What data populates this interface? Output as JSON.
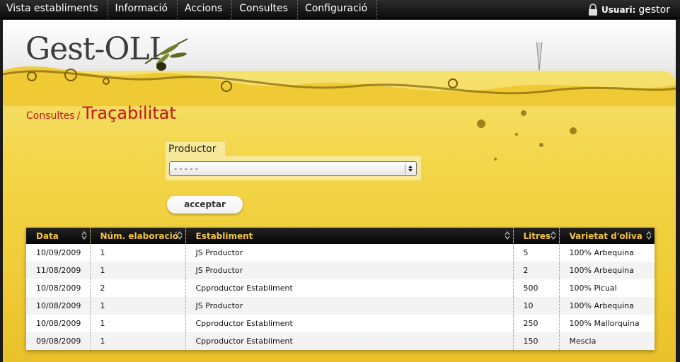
{
  "nav": {
    "items": [
      "Vista establiments",
      "Informació",
      "Accions",
      "Consultes",
      "Configuració"
    ],
    "user_label": "Usuari:",
    "user_name": "gestor"
  },
  "logo": {
    "text": "Gest-OLI"
  },
  "breadcrumb": {
    "parent": "Consultes",
    "separator": "/",
    "current": "Traçabilitat"
  },
  "form": {
    "producer_label": "Productor",
    "producer_value": "- - - - -",
    "submit_label": "acceptar"
  },
  "table": {
    "headers": [
      "Data",
      "Núm. elaboració",
      "Establiment",
      "Litres",
      "Varietat d'oliva"
    ],
    "rows": [
      [
        "10/09/2009",
        "1",
        "JS Productor",
        "5",
        "100% Arbequina"
      ],
      [
        "11/08/2009",
        "1",
        "JS Productor",
        "2",
        "100% Arbequina"
      ],
      [
        "10/08/2009",
        "2",
        "Cpproductor Establiment",
        "500",
        "100% Picual"
      ],
      [
        "10/08/2009",
        "1",
        "JS Productor",
        "10",
        "100% Arbequina"
      ],
      [
        "10/08/2009",
        "1",
        "Cpproductor Establiment",
        "250",
        "100% Mallorquina"
      ],
      [
        "09/08/2009",
        "1",
        "Cpproductor Establiment",
        "150",
        "Mescla"
      ]
    ]
  },
  "colors": {
    "accent_red": "#c4161c",
    "header_gold": "#f2c33d",
    "yellow_bg": "#f3d64a"
  }
}
